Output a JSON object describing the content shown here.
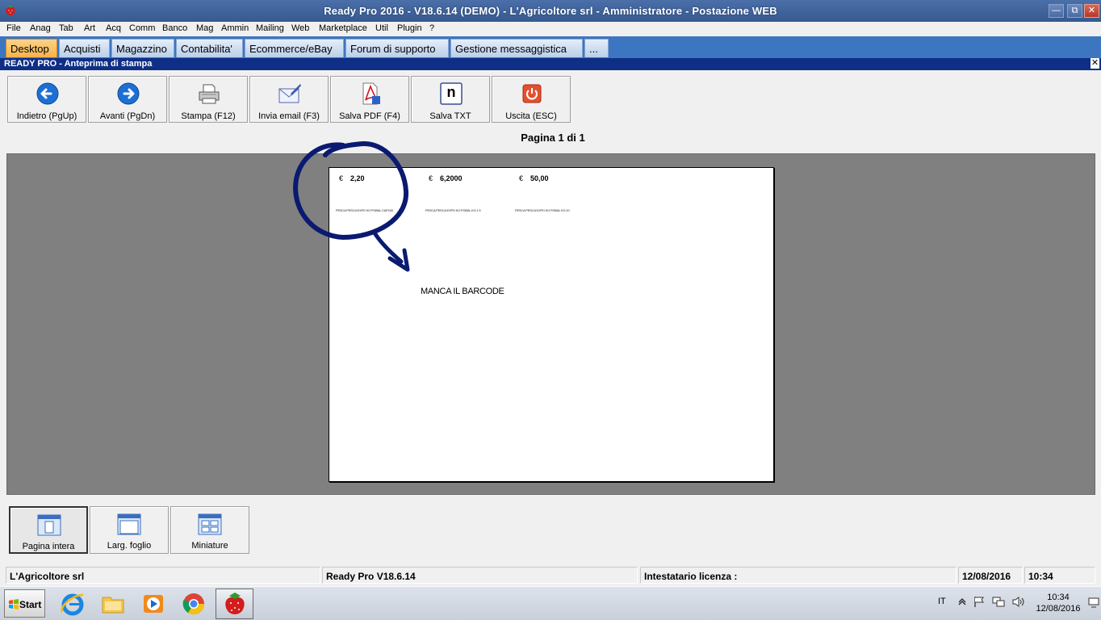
{
  "window": {
    "title": "Ready Pro 2016 - V18.6.14 (DEMO)  - L'Agricoltore srl - Amministratore - Postazione WEB",
    "minimize": "—",
    "maximize": "⧉",
    "close": "✕"
  },
  "menu": [
    "File",
    "Anag",
    "Tab",
    "Art",
    "Acq",
    "Comm",
    "Banco",
    "Mag",
    "Ammin",
    "Mailing",
    "Web",
    "Marketplace",
    "Util",
    "Plugin",
    "?"
  ],
  "tabs": [
    "Desktop",
    "Acquisti",
    "Magazzino",
    "Contabilita'",
    "Ecommerce/eBay",
    "Forum di supporto",
    "Gestione messaggistica",
    "..."
  ],
  "subwindow": {
    "title": "READY PRO - Anteprima di stampa",
    "close": "✕"
  },
  "toolbar": {
    "back": "Indietro (PgUp)",
    "forward": "Avanti (PgDn)",
    "print": "Stampa (F12)",
    "email": "Invia email (F3)",
    "pdf": "Salva PDF (F4)",
    "txt": "Salva TXT",
    "exit": "Uscita (ESC)",
    "txt_glyph": "n"
  },
  "page_info": "Pagina 1 di 1",
  "preview": {
    "labels": [
      {
        "currency": "€",
        "price": "2,20",
        "text": "PESCA PESCA EXPO KO PGBAL CAP100"
      },
      {
        "currency": "€",
        "price": "6,2000",
        "text": "PESCA PESCA EXPO KO PGBAL KG 1 5"
      },
      {
        "currency": "€",
        "price": "50,00",
        "text": "PESCA PESCA EXPO KO PGBAL KG 10"
      }
    ],
    "annotation": "MANCA IL BARCODE"
  },
  "view_buttons": {
    "full_page": "Pagina intera",
    "page_width": "Larg. foglio",
    "thumbnails": "Miniature"
  },
  "status": {
    "company": "L'Agricoltore srl",
    "version": "Ready Pro V18.6.14",
    "license": "Intestatario licenza :",
    "date": "12/08/2016",
    "time": "10:34"
  },
  "taskbar": {
    "start": "Start",
    "language": "IT",
    "clock_time": "10:34",
    "clock_date": "12/08/2016"
  },
  "colors": {
    "titlebar": "#3f64a0",
    "tabs_bar": "#3c76c0",
    "active_tab": "#f6b34a",
    "subhead": "#0f2f86",
    "preview_bg": "#808080",
    "annotation_ink": "#0b1a70"
  }
}
